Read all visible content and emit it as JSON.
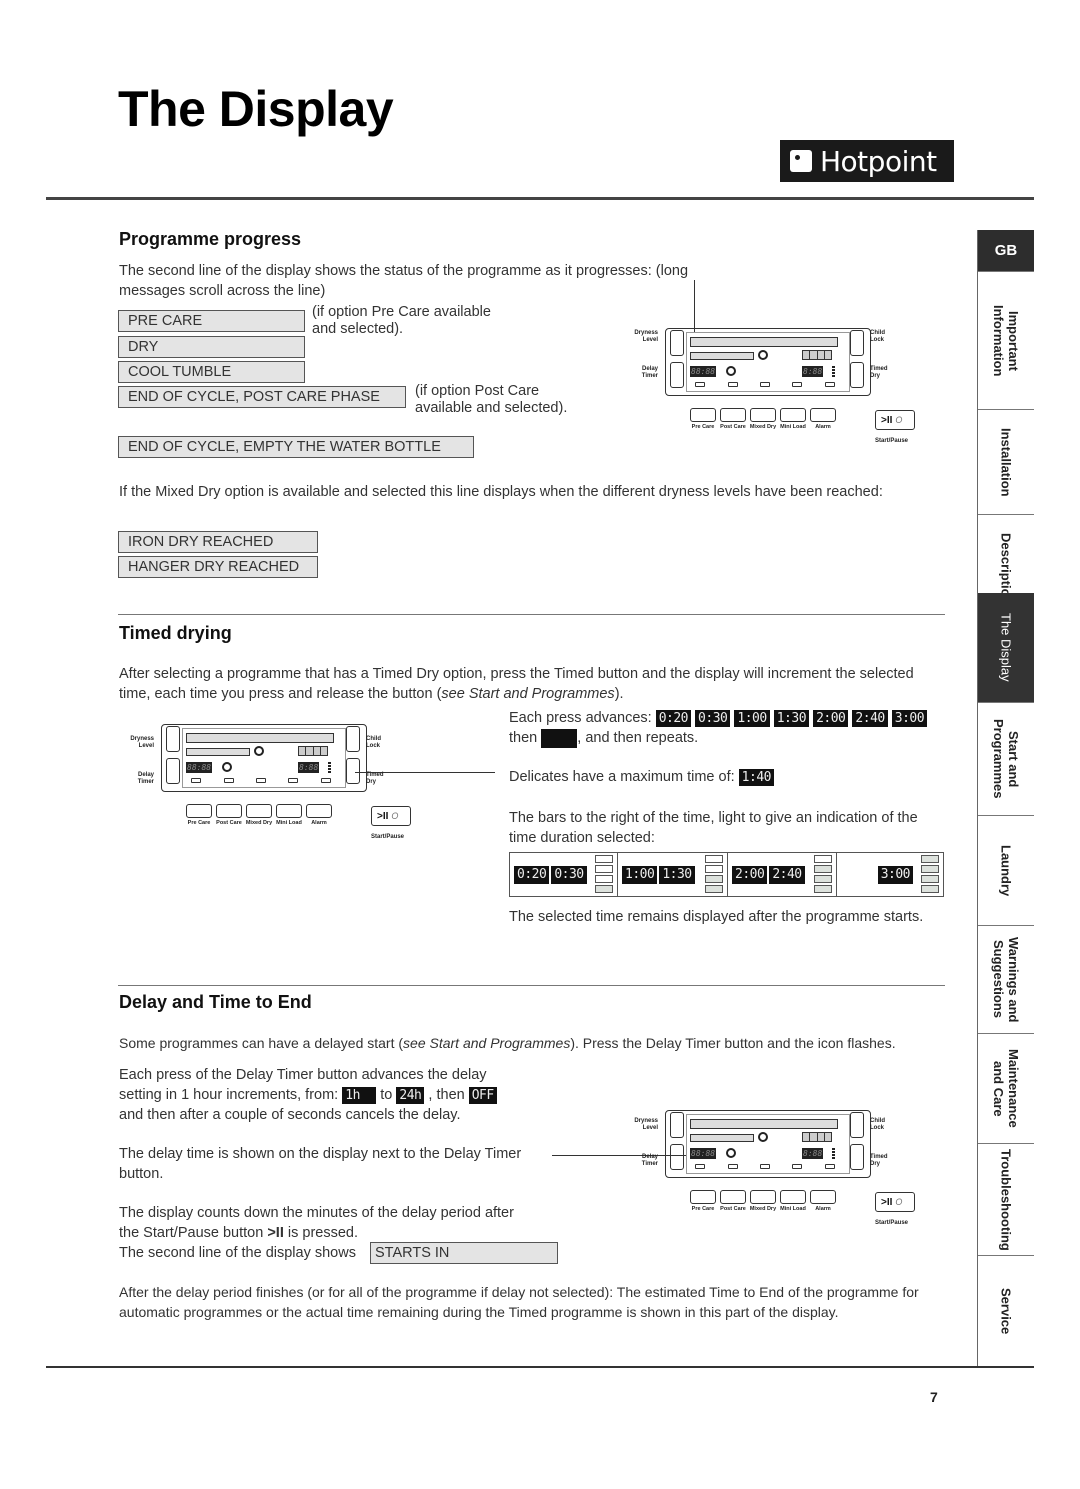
{
  "header": {
    "title": "The Display",
    "brand": "Hotpoint"
  },
  "sidebar": {
    "language": "GB",
    "items": [
      {
        "label": "Important\nInformation",
        "active": false
      },
      {
        "label": "Installation",
        "active": false
      },
      {
        "label": "Description",
        "active": false
      },
      {
        "label": "The Display",
        "active": true
      },
      {
        "label": "Start and\nProgrammes",
        "active": false
      },
      {
        "label": "Laundry",
        "active": false
      },
      {
        "label": "Warnings and\nSuggestions",
        "active": false
      },
      {
        "label": "Maintenance\nand Care",
        "active": false
      },
      {
        "label": "Troubleshooting",
        "active": false
      },
      {
        "label": "Service",
        "active": false
      }
    ]
  },
  "panel_labels": {
    "dryness_level": "Dryness Level",
    "delay_timer": "Delay Timer",
    "child_lock": "Child Lock",
    "timed_dry": "Timed Dry",
    "start_pause": "Start/Pause",
    "start_symbol": ">II",
    "start_o": "O",
    "delay_digits": "88:88",
    "time_digits": "8:88",
    "buttons": [
      "Pre Care",
      "Post Care",
      "Mixed Dry",
      "Mini Load",
      "Alarm"
    ]
  },
  "programme_progress": {
    "heading": "Programme progress",
    "intro": "The second line of the display shows the status of the programme as it progresses: (long messages scroll across the line)",
    "messages": [
      "PRE CARE",
      "DRY",
      "COOL TUMBLE",
      "END OF CYCLE, POST CARE PHASE",
      "END OF CYCLE, EMPTY THE WATER BOTTLE"
    ],
    "note_pre_care": "(if option Pre Care available and selected).",
    "note_post_care": "(if option Post Care available and selected).",
    "mixed_dry_text": "If the Mixed Dry option is available and selected this line displays when the different dryness levels have been reached:",
    "mixed_dry_messages": [
      "IRON DRY REACHED",
      "HANGER DRY REACHED"
    ]
  },
  "timed_drying": {
    "heading": "Timed drying",
    "intro_a": "After selecting a programme that has a Timed Dry option, press the Timed button and the display will increment the selected time, each time you press and release the button (",
    "intro_ref": "see Start and Programmes",
    "intro_b": ").",
    "advances_label": "Each press advances:",
    "advance_times": [
      "0:20",
      "0:30",
      "1:00",
      "1:30",
      "2:00",
      "2:40",
      "3:00"
    ],
    "then_label": "then",
    "repeats_label": ", and then repeats.",
    "delicates_label": "Delicates have a maximum time of:",
    "delicates_max": "1:40",
    "bars_text": "The bars to the right of the time, light to give an indication of the time duration selected:",
    "strip": [
      {
        "times": [
          "0:20",
          "0:30"
        ],
        "bars_lit": 1
      },
      {
        "times": [
          "1:00",
          "1:30"
        ],
        "bars_lit": 2
      },
      {
        "times": [
          "2:00",
          "2:40"
        ],
        "bars_lit": 3
      },
      {
        "times": [
          "3:00"
        ],
        "bars_lit": 4
      }
    ],
    "remains_text": "The selected time remains displayed after the programme starts."
  },
  "delay": {
    "heading": "Delay and Time to End",
    "intro_a": "Some programmes can have a delayed start (",
    "intro_ref": "see Start and Programmes",
    "intro_b": "). Press the Delay Timer button and the icon flashes.",
    "press_a": "Each press of the Delay Timer button advances the delay",
    "press_b": "setting in 1 hour increments, from:",
    "from_value": "1h",
    "to_label": "to",
    "to_value": "24h",
    "then_label": ", then",
    "off_value": "OFF",
    "press_c": "and then after a couple of seconds cancels the delay.",
    "shown_text": "The delay time is shown on the display next to the Delay Timer button.",
    "countdown_a": "The display counts down the minutes of the delay period after",
    "countdown_b": "the Start/Pause button",
    "countdown_symbol": ">II",
    "countdown_c": "is pressed.",
    "second_line_label": "The second line of the display shows",
    "starts_in": "STARTS IN",
    "after_text": "After the delay period finishes (or for all of the programme if delay not selected): The estimated Time to End of the programme for automatic programmes or the actual time remaining during the Timed programme is shown in this part of the display."
  },
  "footer": {
    "page_number": "7"
  }
}
